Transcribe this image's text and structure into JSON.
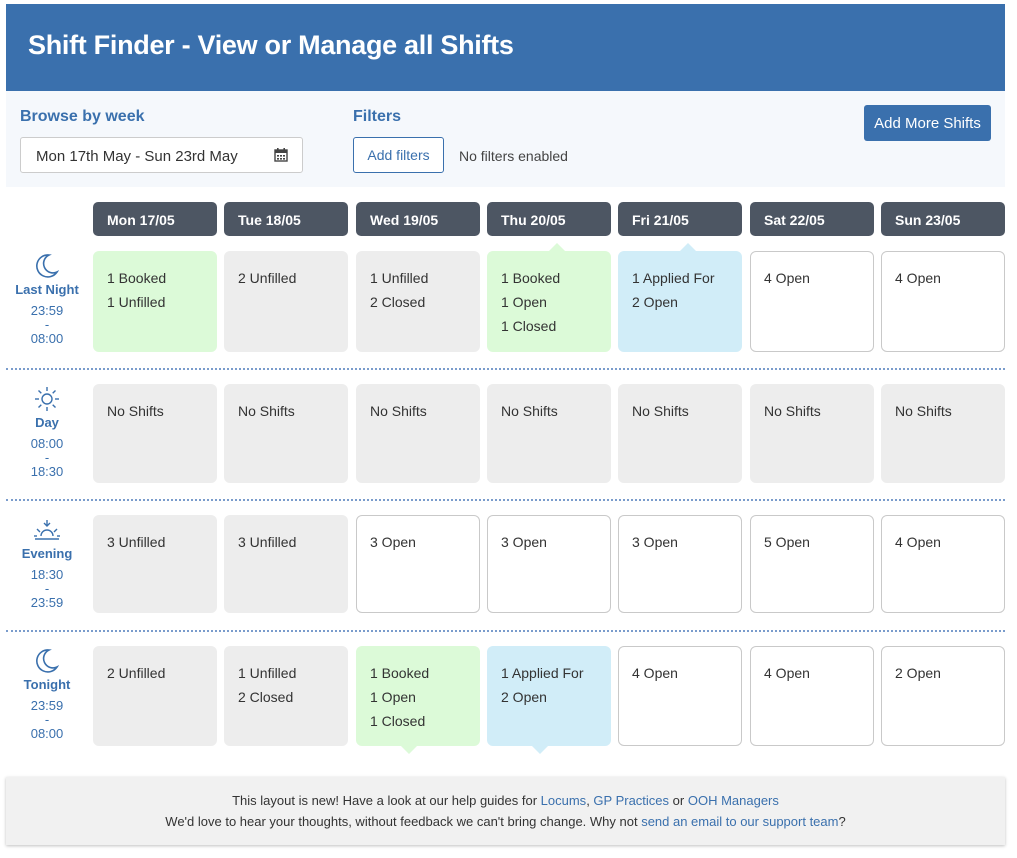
{
  "header": {
    "title": "Shift Finder - View or Manage all Shifts"
  },
  "toolbar": {
    "browse_label": "Browse by week",
    "week_value": "Mon 17th May - Sun 23rd May",
    "filters_label": "Filters",
    "add_filters": "Add filters",
    "filters_status": "No filters enabled",
    "add_shifts": "Add More Shifts"
  },
  "days": [
    "Mon 17/05",
    "Tue 18/05",
    "Wed 19/05",
    "Thu 20/05",
    "Fri 21/05",
    "Sat 22/05",
    "Sun 23/05"
  ],
  "rows": [
    {
      "name": "Last Night",
      "start": "23:59",
      "dash": "-",
      "end": "08:00",
      "icon": "moon-icon",
      "cells": [
        {
          "lines": [
            "1 Booked",
            "1 Unfilled"
          ],
          "status": "booked"
        },
        {
          "lines": [
            "2 Unfilled"
          ],
          "status": "unfilled"
        },
        {
          "lines": [
            "1 Unfilled",
            "2 Closed"
          ],
          "status": "unfilled"
        },
        {
          "lines": [
            "1 Booked",
            "1 Open",
            "1 Closed"
          ],
          "status": "booked"
        },
        {
          "lines": [
            "1 Applied For",
            "2 Open"
          ],
          "status": "applied"
        },
        {
          "lines": [
            "4 Open"
          ],
          "status": "open"
        },
        {
          "lines": [
            "4 Open"
          ],
          "status": "open"
        }
      ]
    },
    {
      "name": "Day",
      "start": "08:00",
      "dash": "-",
      "end": "18:30",
      "icon": "sun-icon",
      "cells": [
        {
          "lines": [
            "No Shifts"
          ],
          "status": "none"
        },
        {
          "lines": [
            "No Shifts"
          ],
          "status": "none"
        },
        {
          "lines": [
            "No Shifts"
          ],
          "status": "none"
        },
        {
          "lines": [
            "No Shifts"
          ],
          "status": "none"
        },
        {
          "lines": [
            "No Shifts"
          ],
          "status": "none"
        },
        {
          "lines": [
            "No Shifts"
          ],
          "status": "none"
        },
        {
          "lines": [
            "No Shifts"
          ],
          "status": "none"
        }
      ]
    },
    {
      "name": "Evening",
      "start": "18:30",
      "dash": "-",
      "end": "23:59",
      "icon": "sunset-icon",
      "cells": [
        {
          "lines": [
            "3 Unfilled"
          ],
          "status": "unfilled"
        },
        {
          "lines": [
            "3 Unfilled"
          ],
          "status": "unfilled"
        },
        {
          "lines": [
            "3 Open"
          ],
          "status": "open"
        },
        {
          "lines": [
            "3 Open"
          ],
          "status": "open"
        },
        {
          "lines": [
            "3 Open"
          ],
          "status": "open"
        },
        {
          "lines": [
            "5 Open"
          ],
          "status": "open"
        },
        {
          "lines": [
            "4 Open"
          ],
          "status": "open"
        }
      ]
    },
    {
      "name": "Tonight",
      "start": "23:59",
      "dash": "-",
      "end": "08:00",
      "icon": "moon-icon",
      "cells": [
        {
          "lines": [
            "2 Unfilled"
          ],
          "status": "unfilled"
        },
        {
          "lines": [
            "1 Unfilled",
            "2 Closed"
          ],
          "status": "unfilled"
        },
        {
          "lines": [
            "1 Booked",
            "1 Open",
            "1 Closed"
          ],
          "status": "booked"
        },
        {
          "lines": [
            "1 Applied For",
            "2 Open"
          ],
          "status": "applied"
        },
        {
          "lines": [
            "4 Open"
          ],
          "status": "open"
        },
        {
          "lines": [
            "4 Open"
          ],
          "status": "open"
        },
        {
          "lines": [
            "2 Open"
          ],
          "status": "open"
        }
      ]
    }
  ],
  "footer": {
    "line1_pre": "This layout is new! Have a look at our help guides for ",
    "link_locums": "Locums",
    "comma": ", ",
    "link_gp": "GP Practices",
    "or": " or ",
    "link_ooh": "OOH Managers",
    "line2_pre": "We'd love to hear your thoughts, without feedback we can't bring change. Why not ",
    "link_email": "send an email to our support team",
    "line2_post": "?"
  },
  "colors": {
    "brand": "#3a70ad",
    "booked": "#dcfad8",
    "applied": "#d1edf8",
    "unfilled": "#ededed",
    "day_header": "#4d5663"
  }
}
